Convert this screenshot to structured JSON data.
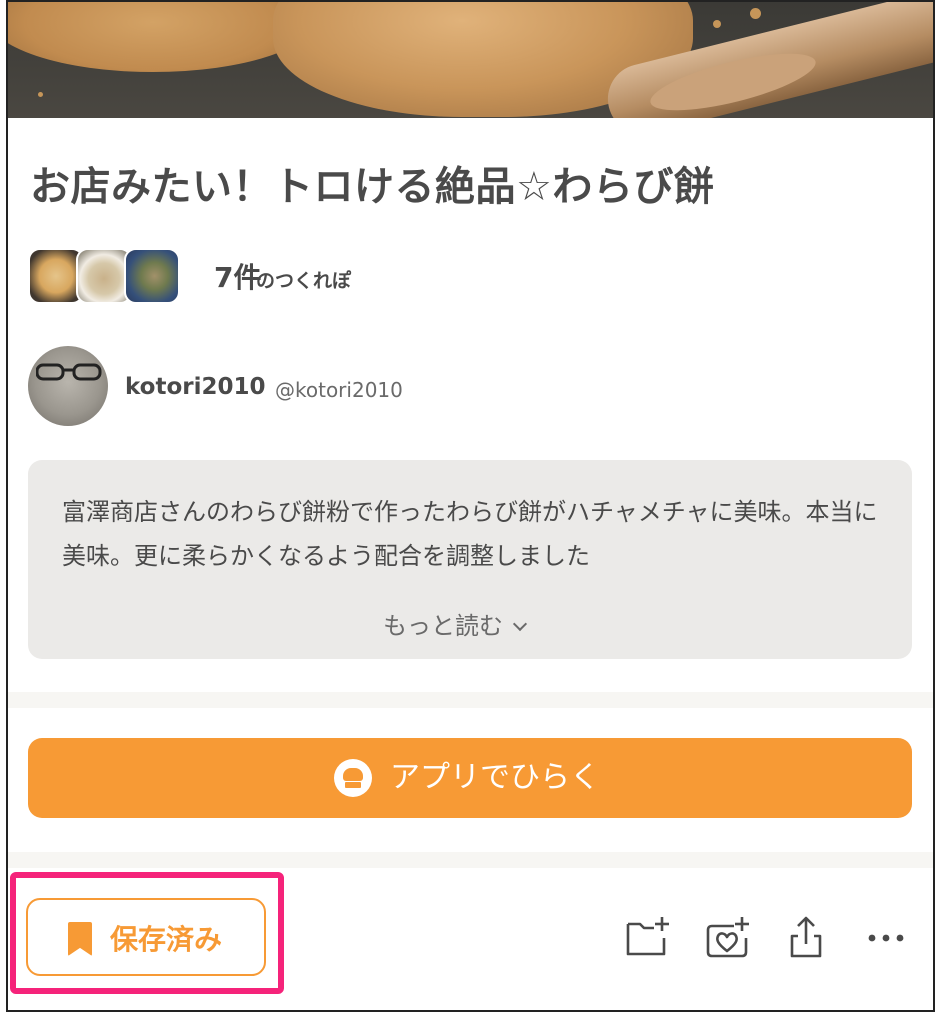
{
  "recipe": {
    "title": "お店みたい！トロける絶品☆わらび餅"
  },
  "tsukurepo": {
    "count": "7件",
    "label": "のつくれぽ"
  },
  "author": {
    "name": "kotori2010",
    "handle": "@kotori2010"
  },
  "description": {
    "text": "富澤商店さんのわらび餅粉で作ったわらび餅がハチャメチャに美味。本当に美味。更に柔らかくなるよう配合を調整しました",
    "read_more": "もっと読む"
  },
  "app_button": {
    "label": "アプリでひらく"
  },
  "actions": {
    "saved_label": "保存済み",
    "icons": [
      "add-to-folder-icon",
      "add-favorite-icon",
      "share-icon",
      "more-icon"
    ]
  },
  "colors": {
    "accent": "#f79a35",
    "highlight": "#f5237a",
    "description_bg": "#ebeae8",
    "text": "#4a4a4a"
  }
}
